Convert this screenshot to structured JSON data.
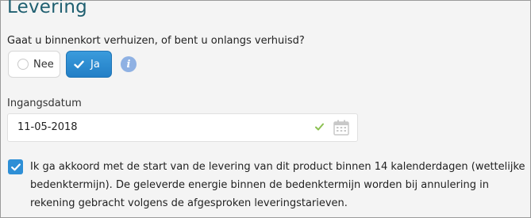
{
  "section": {
    "title": "Levering"
  },
  "move_question": {
    "label": "Gaat u binnenkort verhuizen, of bent u onlangs verhuisd?",
    "options": [
      {
        "label": "Nee",
        "selected": false
      },
      {
        "label": "Ja",
        "selected": true
      }
    ],
    "info_icon": "info-icon"
  },
  "start_date": {
    "label": "Ingangsdatum",
    "value": "11-05-2018",
    "valid_icon": "checkmark-icon",
    "picker_icon": "calendar-icon"
  },
  "agreement": {
    "checked": true,
    "text": "Ik ga akkoord met de start van de levering van dit product binnen 14 kalenderdagen (wettelijke bedenktermijn). De geleverde energie binnen de bedenktermijn worden bij annulering in rekening gebracht volgens de afgesproken leveringstarieven."
  },
  "colors": {
    "title": "#1f5f70",
    "primary": "#2e8fd6",
    "info": "#8fb1e3",
    "valid": "#8cc152"
  }
}
